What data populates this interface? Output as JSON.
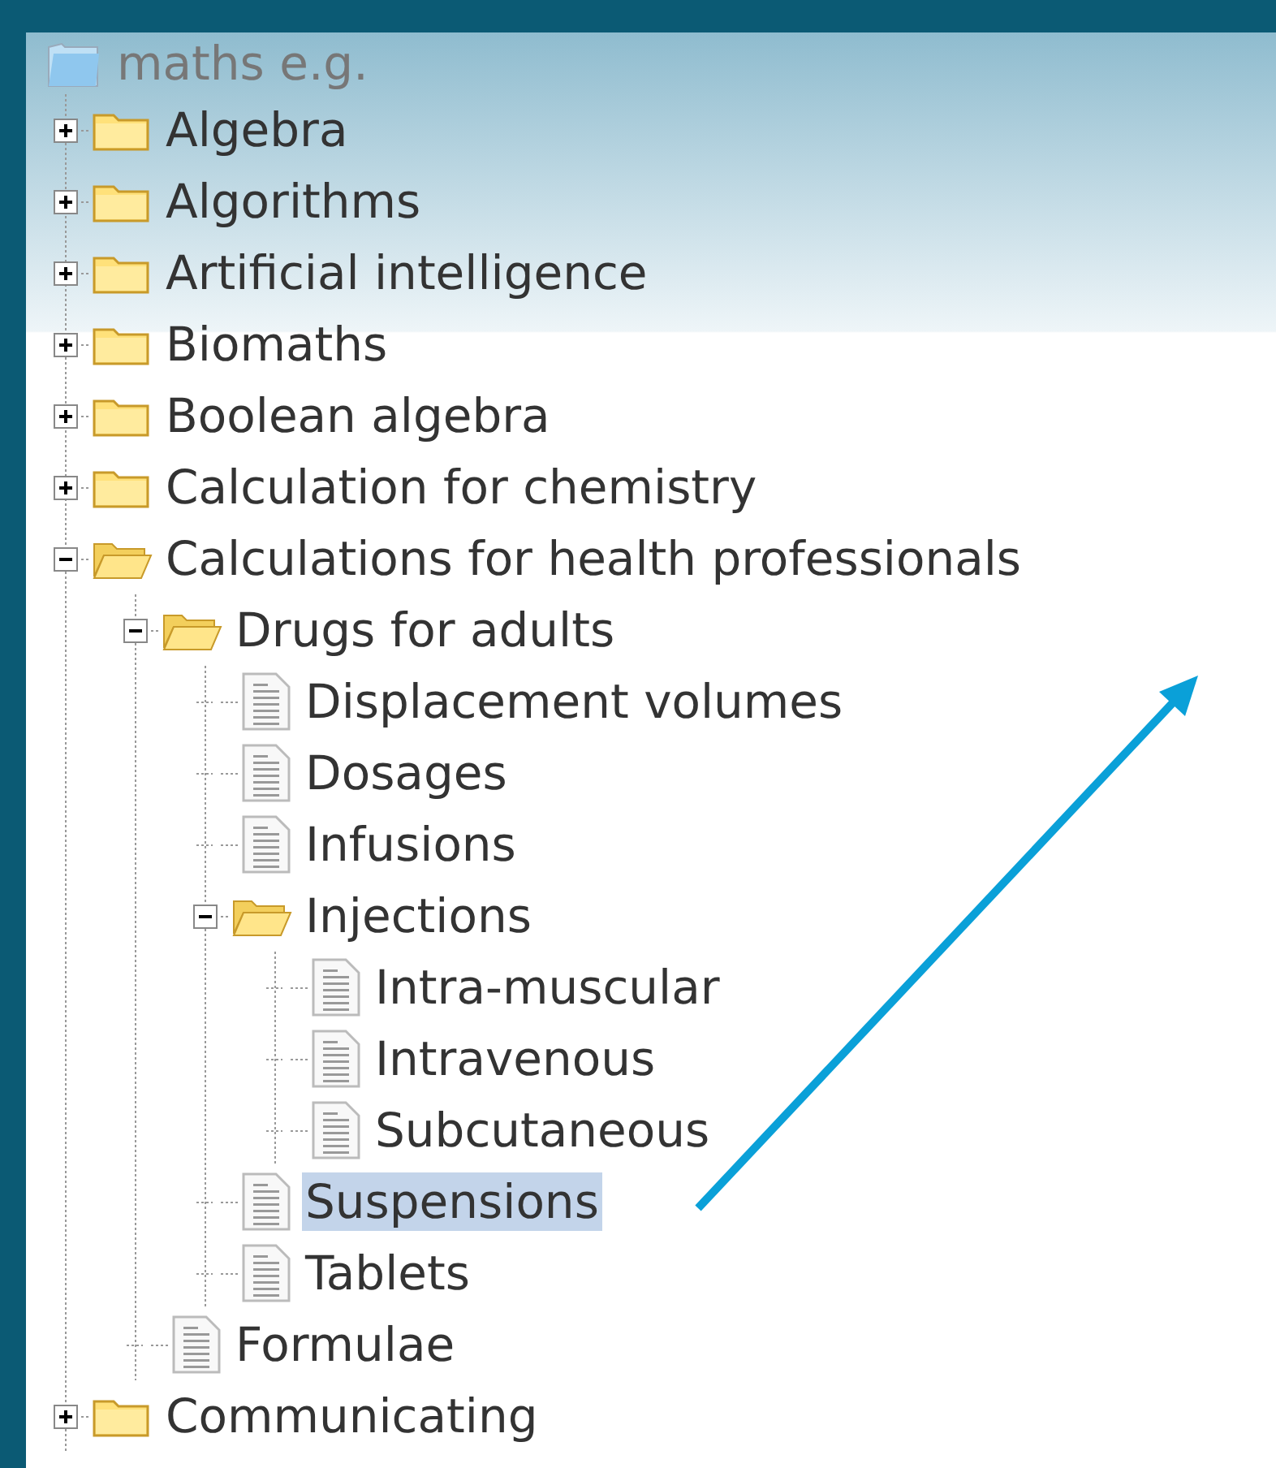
{
  "tree": {
    "label": "maths e.g.",
    "kind": "root",
    "selected": false,
    "children": [
      {
        "label": "Algebra",
        "kind": "folder",
        "expanded": false,
        "selected": false
      },
      {
        "label": "Algorithms",
        "kind": "folder",
        "expanded": false,
        "selected": false
      },
      {
        "label": "Artificial intelligence",
        "kind": "folder",
        "expanded": false,
        "selected": false
      },
      {
        "label": "Biomaths",
        "kind": "folder",
        "expanded": false,
        "selected": false
      },
      {
        "label": "Boolean algebra",
        "kind": "folder",
        "expanded": false,
        "selected": false
      },
      {
        "label": "Calculation for chemistry",
        "kind": "folder",
        "expanded": false,
        "selected": false
      },
      {
        "label": "Calculations for health professionals",
        "kind": "folder",
        "expanded": true,
        "selected": false,
        "children": [
          {
            "label": "Drugs for adults",
            "kind": "folder",
            "expanded": true,
            "selected": false,
            "children": [
              {
                "label": "Displacement volumes",
                "kind": "file",
                "selected": false
              },
              {
                "label": "Dosages",
                "kind": "file",
                "selected": false
              },
              {
                "label": "Infusions",
                "kind": "file",
                "selected": false
              },
              {
                "label": "Injections",
                "kind": "folder",
                "expanded": true,
                "selected": false,
                "children": [
                  {
                    "label": "Intra-muscular",
                    "kind": "file",
                    "selected": false
                  },
                  {
                    "label": "Intravenous",
                    "kind": "file",
                    "selected": false
                  },
                  {
                    "label": "Subcutaneous",
                    "kind": "file",
                    "selected": false
                  }
                ]
              },
              {
                "label": "Suspensions",
                "kind": "file",
                "selected": true
              },
              {
                "label": "Tablets",
                "kind": "file",
                "selected": false
              }
            ]
          },
          {
            "label": "Formulae",
            "kind": "file",
            "selected": false
          }
        ]
      },
      {
        "label": "Communicating",
        "kind": "folder",
        "expanded": false,
        "selected": false
      }
    ]
  }
}
